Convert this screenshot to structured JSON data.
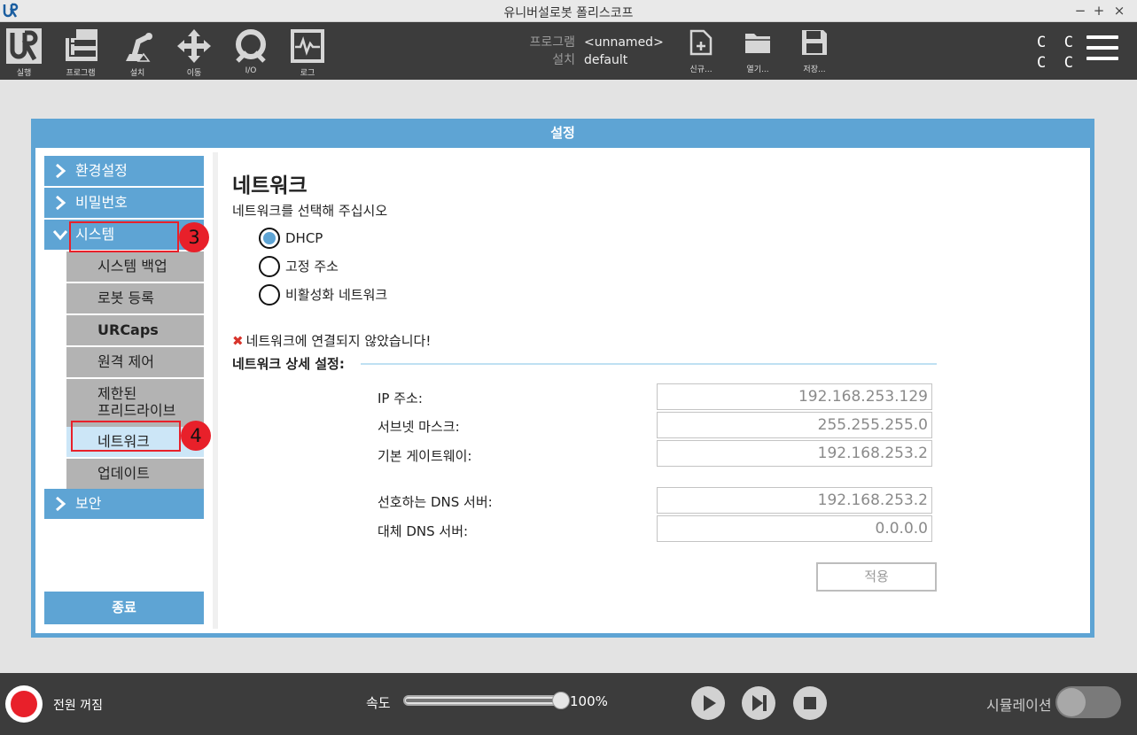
{
  "window": {
    "title": "유니버설로봇 폴리스코프",
    "minimize": "−",
    "maximize": "+",
    "close": "×"
  },
  "toolbar": {
    "tools": [
      {
        "id": "run",
        "label": "실행",
        "icon": "ur-logo-icon"
      },
      {
        "id": "program",
        "label": "프로그램",
        "icon": "program-icon"
      },
      {
        "id": "install",
        "label": "설치",
        "icon": "robot-arm-icon"
      },
      {
        "id": "move",
        "label": "이동",
        "icon": "move-arrows-icon"
      },
      {
        "id": "io",
        "label": "I/O",
        "icon": "io-icon"
      },
      {
        "id": "log",
        "label": "로그",
        "icon": "log-icon"
      }
    ],
    "program_key": "프로그램",
    "program_value": "<unnamed>",
    "install_key": "설치",
    "install_value": "default",
    "file_buttons": [
      {
        "id": "new",
        "label": "신규...",
        "icon": "new-file-icon"
      },
      {
        "id": "open",
        "label": "열기...",
        "icon": "folder-icon"
      },
      {
        "id": "save",
        "label": "저장...",
        "icon": "save-icon"
      }
    ],
    "cc_text": "C C\nC C"
  },
  "dialog": {
    "title": "설정",
    "sidebar": {
      "items": [
        {
          "label": "환경설정",
          "expanded": false
        },
        {
          "label": "비밀번호",
          "expanded": false
        },
        {
          "label": "시스템",
          "expanded": true
        },
        {
          "label": "보안",
          "expanded": false
        }
      ],
      "system_sub": [
        {
          "label": "시스템 백업"
        },
        {
          "label": "로봇 등록"
        },
        {
          "label": "URCaps"
        },
        {
          "label": "원격 제어"
        },
        {
          "label": "제한된\n프리드라이브"
        },
        {
          "label": "네트워크",
          "selected": true
        },
        {
          "label": "업데이트"
        }
      ],
      "exit_label": "종료",
      "annotation_3": "3",
      "annotation_4": "4"
    },
    "network": {
      "heading": "네트워크",
      "prompt": "네트워크를 선택해 주십시오",
      "options": [
        {
          "label": "DHCP",
          "selected": true
        },
        {
          "label": "고정 주소",
          "selected": false
        },
        {
          "label": "비활성화 네트워크",
          "selected": false
        }
      ],
      "status_icon": "✖",
      "status_text": "네트워크에 연결되지 않았습니다!",
      "details_title": "네트워크 상세 설정:",
      "fields": [
        {
          "label": "IP 주소:",
          "value": "192.168.253.129"
        },
        {
          "label": "서브넷 마스크:",
          "value": "255.255.255.0"
        },
        {
          "label": "기본 게이트웨이:",
          "value": "192.168.253.2"
        },
        {
          "label": "선호하는 DNS 서버:",
          "value": "192.168.253.2"
        },
        {
          "label": "대체 DNS 서버:",
          "value": "0.0.0.0"
        }
      ],
      "apply_label": "적용"
    }
  },
  "footer": {
    "power_label": "전원 꺼짐",
    "speed_label": "속도",
    "speed_value": "100%",
    "speed_percent": 100,
    "simulation_label": "시뮬레이션",
    "simulation_on": false
  },
  "colors": {
    "accent": "#5ea4d4",
    "toolbar_bg": "#3c3c3c",
    "annotation": "#e8202a",
    "selected_item": "#cce6f7"
  }
}
